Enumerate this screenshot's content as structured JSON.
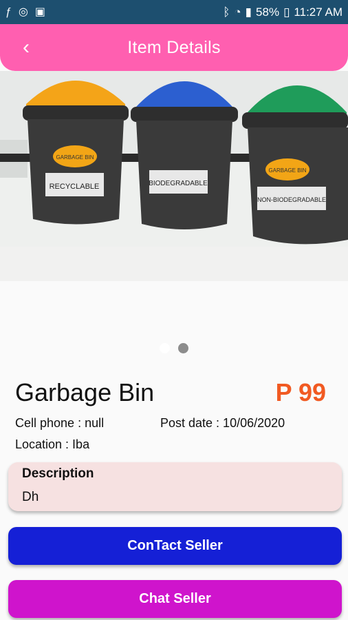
{
  "status_bar": {
    "battery": "58%",
    "time": "11:27 AM",
    "icons": [
      "facebook-messenger-icon",
      "vpn-icon",
      "clipboard-icon",
      "bluetooth-icon",
      "wifi-icon",
      "signal-icon",
      "battery-icon"
    ]
  },
  "app_bar": {
    "title": "Item Details",
    "back_icon": "chevron-left-icon"
  },
  "image": {
    "bins": [
      {
        "label": "RECYCLABLE",
        "color": "#f4a418"
      },
      {
        "label": "BIODEGRADABLE",
        "color": "#2c5fd0"
      },
      {
        "label": "NON-BIODEGRADABLE",
        "color": "#1f9c5a"
      }
    ],
    "brand": "GARBAGE BIN"
  },
  "pager": {
    "total": 2,
    "active": 2
  },
  "item": {
    "title": "Garbage Bin",
    "price": "P 99",
    "cell_phone": "Cell phone : null",
    "post_date": "Post date : 10/06/2020",
    "location": "Location : Iba"
  },
  "description": {
    "label": "Description",
    "text": "Dh"
  },
  "buttons": {
    "contact": "ConTact Seller",
    "chat": "Chat Seller"
  },
  "colors": {
    "status_bar": "#1d4f6f",
    "app_bar": "#ff5fb0",
    "price": "#f15a22",
    "contact_button": "#1520d6",
    "chat_button": "#cf14cc",
    "description_bg": "#f6e1e1"
  }
}
